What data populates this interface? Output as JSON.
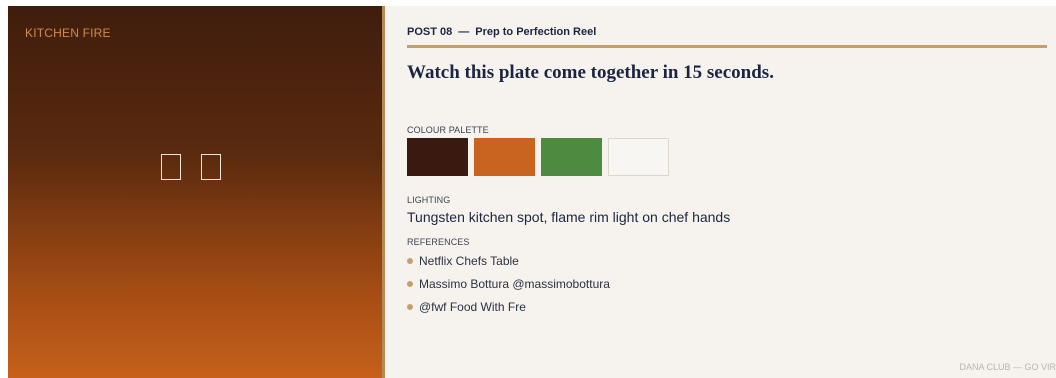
{
  "left_panel": {
    "brand": "KITCHEN FIRE"
  },
  "post": {
    "number": "POST 08",
    "separator": "—",
    "title": "Prep to Perfection Reel",
    "headline": "Watch this plate come together in 15 seconds."
  },
  "palette": {
    "label": "COLOUR PALETTE",
    "colors": [
      "#3a1a10",
      "#c8641f",
      "#4e8a3f",
      "#f8f6f2"
    ]
  },
  "lighting": {
    "label": "LIGHTING",
    "value": "Tungsten kitchen spot, flame rim light on chef hands"
  },
  "references": {
    "label": "REFERENCES",
    "items": [
      "Netflix Chefs Table",
      "Massimo Bottura @massimobottura",
      "@fwf Food With Fre"
    ]
  },
  "footer": {
    "text": "DANA CLUB — GO VIR"
  },
  "colors": {
    "accent": "#c79f6e",
    "navy": "#1c2540",
    "brand": "#d28a45"
  }
}
